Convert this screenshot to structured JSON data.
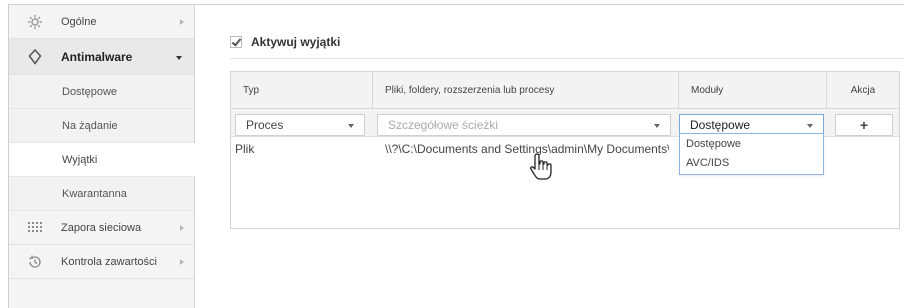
{
  "sidebar": {
    "items": [
      {
        "label": "Ogólne",
        "icon": "gear-icon"
      },
      {
        "label": "Antimalware",
        "icon": "shield-icon"
      },
      {
        "label": "Zapora sieciowa",
        "icon": "firewall-grid-icon"
      },
      {
        "label": "Kontrola zawartości",
        "icon": "history-icon"
      }
    ],
    "subitems": [
      "Dostępowe",
      "Na żądanie",
      "Wyjątki",
      "Kwarantanna"
    ]
  },
  "main": {
    "activate_label": "Aktywuj wyjątki",
    "activate_checked": true,
    "table": {
      "headers": [
        "Typ",
        "Pliki, foldery, rozszerzenia lub procesy",
        "Moduły",
        "Akcja"
      ],
      "edit": {
        "type_value": "Proces",
        "path_placeholder": "Szczegółowe ścieżki",
        "module_value": "Dostępowe",
        "add_label": "+"
      },
      "rows": [
        {
          "type": "Plik",
          "path": "\\\\?\\C:\\Documents and Settings\\admin\\My Documents\\..."
        }
      ]
    },
    "module_options": [
      "Dostępowe",
      "AVC/IDS"
    ]
  }
}
